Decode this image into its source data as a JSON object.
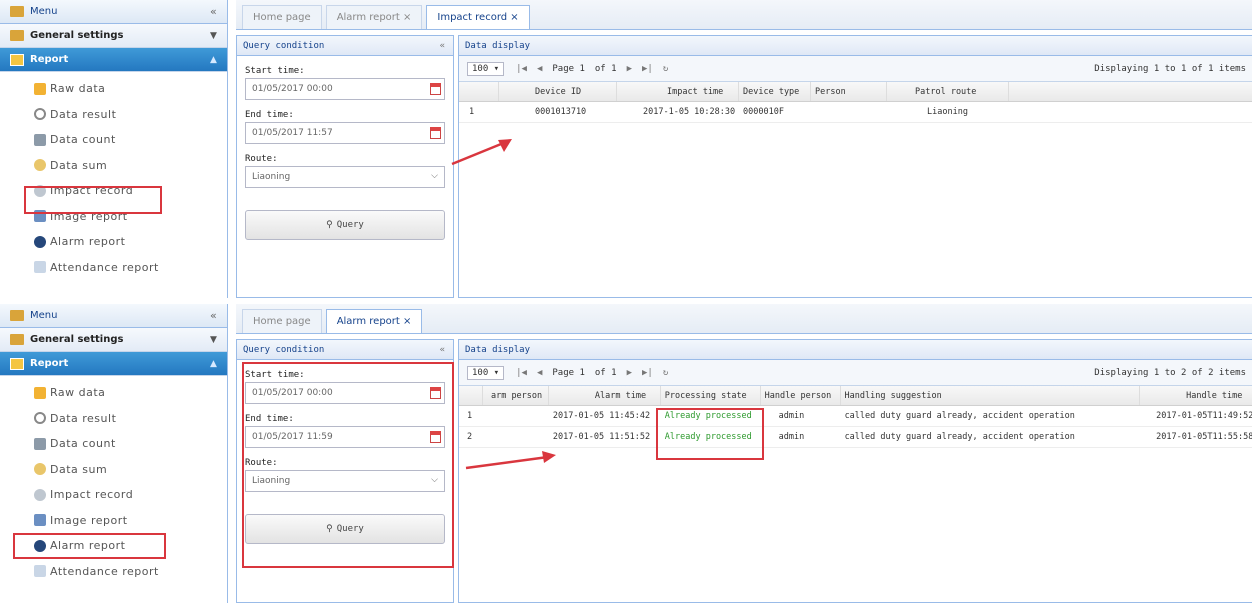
{
  "colors": {
    "accent_blue": "#2478c0",
    "highlight_red": "#d9363e",
    "processed_green": "#2e9a2e"
  },
  "sidebar": {
    "menu_title": "Menu",
    "collapse_glyph": "«",
    "general_settings": "General settings",
    "report": "Report",
    "items": [
      {
        "label": "Raw data",
        "icon": "raw-data-icon"
      },
      {
        "label": "Data result",
        "icon": "search-icon"
      },
      {
        "label": "Data count",
        "icon": "data-count-icon"
      },
      {
        "label": "Data sum",
        "icon": "data-sum-icon"
      },
      {
        "label": "Impact record",
        "icon": "impact-record-icon"
      },
      {
        "label": "Image report",
        "icon": "image-report-icon"
      },
      {
        "label": "Alarm report",
        "icon": "alarm-report-icon"
      },
      {
        "label": "Attendance report",
        "icon": "attendance-report-icon"
      }
    ]
  },
  "panel1": {
    "tabs": [
      "Home page",
      "Alarm report ×",
      "Impact record ×"
    ],
    "query": {
      "header": "Query condition",
      "start_label": "Start time:",
      "start_value": "01/05/2017 00:00",
      "end_label": "End time:",
      "end_value": "01/05/2017 11:57",
      "route_label": "Route:",
      "route_value": "Liaoning",
      "button": "Query"
    },
    "data": {
      "header": "Data display",
      "page_size": "100 ▾",
      "page_label": "Page 1",
      "of_label": "of 1",
      "displaying": "Displaying 1 to 1 of 1 items",
      "columns": [
        "",
        "Device ID",
        "Impact time",
        "Device type",
        "Person",
        "Patrol route"
      ],
      "rows": [
        [
          "1",
          "0001013710",
          "2017-1-05 10:28:30",
          "0000010F",
          "",
          "Liaoning"
        ]
      ]
    }
  },
  "panel2": {
    "tabs": [
      "Home page",
      "Alarm report ×"
    ],
    "query": {
      "header": "Query condition",
      "start_label": "Start time:",
      "start_value": "01/05/2017 00:00",
      "end_label": "End time:",
      "end_value": "01/05/2017 11:59",
      "route_label": "Route:",
      "route_value": "Liaoning",
      "button": "Query"
    },
    "data": {
      "header": "Data display",
      "page_size": "100 ▾",
      "page_label": "Page 1",
      "of_label": "of 1",
      "displaying": "Displaying 1 to 2 of 2 items",
      "columns": [
        "",
        "arm person",
        "Alarm time",
        "Processing state",
        "Handle person",
        "Handling suggestion",
        "Handle time"
      ],
      "rows": [
        [
          "1",
          "",
          "2017-01-05 11:45:42",
          "Already processed",
          "admin",
          "called duty guard already, accident operation",
          "2017-01-05T11:49:52"
        ],
        [
          "2",
          "",
          "2017-01-05 11:51:52",
          "Already processed",
          "admin",
          "called duty guard already, accident operation",
          "2017-01-05T11:55:58"
        ]
      ]
    }
  }
}
